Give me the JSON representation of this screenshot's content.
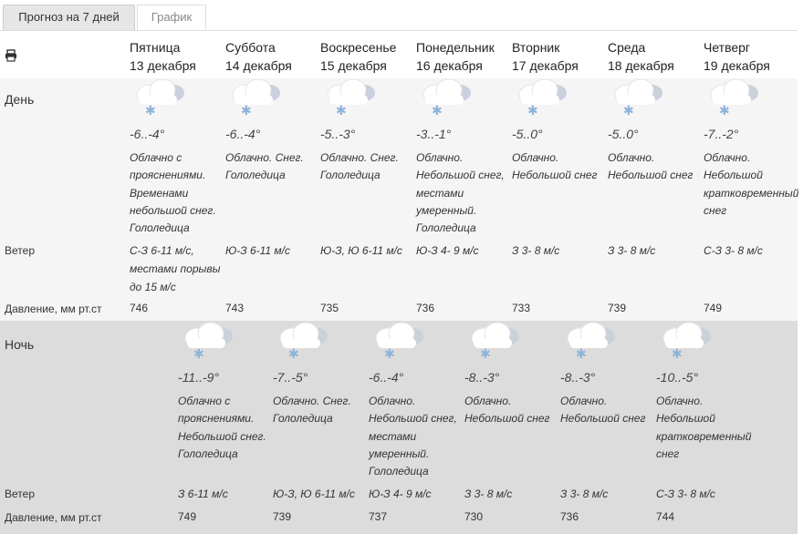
{
  "tabs": [
    {
      "label": "Прогноз на 7 дней",
      "active": true
    },
    {
      "label": "График",
      "active": false
    }
  ],
  "day_section_label": "День",
  "night_section_label": "Ночь",
  "row_labels": {
    "wind": "Ветер",
    "pressure": "Давление, мм рт.ст"
  },
  "days": [
    {
      "weekday": "Пятница",
      "date": "13 декабря"
    },
    {
      "weekday": "Суббота",
      "date": "14 декабря"
    },
    {
      "weekday": "Воскресенье",
      "date": "15 декабря"
    },
    {
      "weekday": "Понедельник",
      "date": "16 декабря"
    },
    {
      "weekday": "Вторник",
      "date": "17 декабря"
    },
    {
      "weekday": "Среда",
      "date": "18 декабря"
    },
    {
      "weekday": "Четверг",
      "date": "19 декабря"
    }
  ],
  "day_forecast": [
    {
      "temp": "-6..-4°",
      "desc": "Облачно с прояснениями. Временами небольшой снег. Гололедица",
      "wind": "С-З 6-11 м/с, местами порывы до 15 м/с",
      "pressure": "746",
      "icon": "cloud-snow-icon"
    },
    {
      "temp": "-6..-4°",
      "desc": "Облачно. Снег. Гололедица",
      "wind": "Ю-З 6-11 м/с",
      "pressure": "743",
      "icon": "cloud-snow-icon"
    },
    {
      "temp": "-5..-3°",
      "desc": "Облачно. Снег. Гололедица",
      "wind": "Ю-З, Ю 6-11 м/с",
      "pressure": "735",
      "icon": "cloud-snow-icon"
    },
    {
      "temp": "-3..-1°",
      "desc": "Облачно. Небольшой снег, местами умеренный. Гололедица",
      "wind": "Ю-З 4- 9 м/с",
      "pressure": "736",
      "icon": "cloud-snow-icon"
    },
    {
      "temp": "-5..0°",
      "desc": "Облачно. Небольшой снег",
      "wind": "З 3- 8 м/с",
      "pressure": "733",
      "icon": "cloud-snow-icon"
    },
    {
      "temp": "-5..0°",
      "desc": "Облачно. Небольшой снег",
      "wind": "З 3- 8 м/с",
      "pressure": "739",
      "icon": "cloud-snow-icon"
    },
    {
      "temp": "-7..-2°",
      "desc": "Облачно. Небольшой кратковременный снег",
      "wind": "С-З 3- 8 м/с",
      "pressure": "749",
      "icon": "cloud-snow-icon"
    }
  ],
  "night_forecast": [
    {
      "temp": "-11..-9°",
      "desc": "Облачно с прояснениями. Небольшой снег. Гололедица",
      "wind": "З 6-11 м/с",
      "pressure": "749",
      "icon": "cloud-snow-icon"
    },
    {
      "temp": "-7..-5°",
      "desc": "Облачно. Снег. Гололедица",
      "wind": "Ю-З, Ю 6-11 м/с",
      "pressure": "739",
      "icon": "cloud-snow-icon"
    },
    {
      "temp": "-6..-4°",
      "desc": "Облачно. Небольшой снег, местами умеренный. Гололедица",
      "wind": "Ю-З 4- 9 м/с",
      "pressure": "737",
      "icon": "cloud-snow-icon"
    },
    {
      "temp": "-8..-3°",
      "desc": "Облачно. Небольшой снег",
      "wind": "З 3- 8 м/с",
      "pressure": "730",
      "icon": "cloud-snow-icon"
    },
    {
      "temp": "-8..-3°",
      "desc": "Облачно. Небольшой снег",
      "wind": "З 3- 8 м/с",
      "pressure": "736",
      "icon": "cloud-snow-icon"
    },
    {
      "temp": "-10..-5°",
      "desc": "Облачно. Небольшой кратковременный снег",
      "wind": "С-З 3- 8 м/с",
      "pressure": "744",
      "icon": "cloud-snow-icon"
    }
  ],
  "colors": {
    "day_band": "#f5f5f5",
    "night_band": "#dcdcdc",
    "snowflake": "#8fb3d9",
    "tab_active": "#e6e6e6"
  },
  "print_icon": "printer-icon"
}
